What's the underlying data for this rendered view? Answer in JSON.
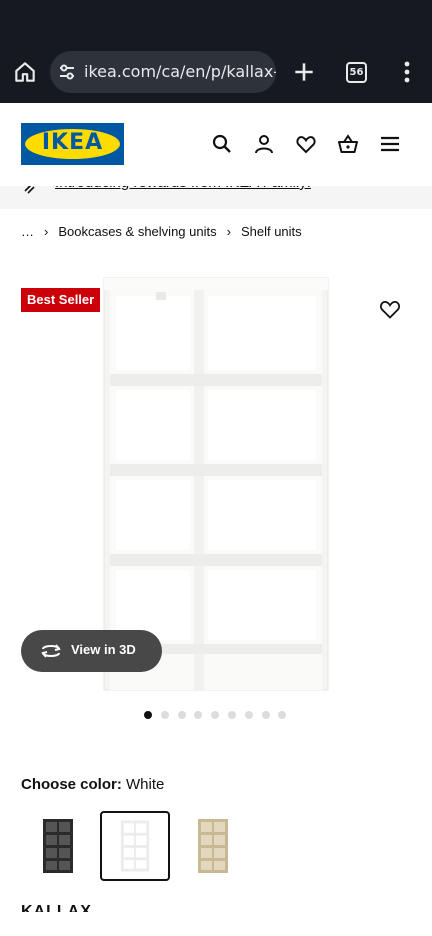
{
  "browser": {
    "url": "ikea.com/ca/en/p/kallax-",
    "tab_count": "56"
  },
  "header": {
    "logo_text": "IKEA",
    "brand_colors": {
      "blue": "#0058a3",
      "yellow": "#ffdb00"
    }
  },
  "promo": {
    "text": "Introducing rewards from IKEA Family!"
  },
  "breadcrumb": [
    "…",
    "Bookcases & shelving units",
    "Shelf units"
  ],
  "product": {
    "badge": "Best Seller",
    "badge_color": "#cc0008",
    "view3d_label": "View in 3D",
    "gallery": {
      "total": 9,
      "active_index": 0
    },
    "color_label": "Choose color:",
    "color_value": "White",
    "swatches": [
      {
        "name": "black-brown",
        "color": "#2b2b2b",
        "selected": false
      },
      {
        "name": "white",
        "color": "#ffffff",
        "selected": true
      },
      {
        "name": "white stained oak effect",
        "color": "#d2c2a4",
        "selected": false
      }
    ],
    "name_partial": "KALLAX"
  }
}
